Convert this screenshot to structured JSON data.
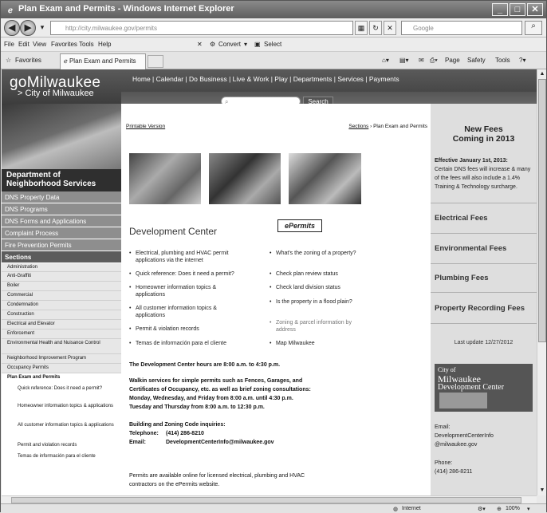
{
  "window": {
    "title": "Plan Exam and Permits - Windows Internet Explorer",
    "address": "http://city.milwaukee.gov/permits",
    "address_domain": "milwaukee.gov",
    "search_placeholder": "Google",
    "menus": [
      "File",
      "Edit",
      "View",
      "Favorites",
      "Tools",
      "Help"
    ],
    "toolbar_convert": "Convert",
    "toolbar_select": "Select",
    "favorites": "Favorites",
    "tab_title": "Plan Exam and Permits",
    "cmd_page": "Page",
    "cmd_safety": "Safety",
    "cmd_tools": "Tools",
    "status_zone": "Internet",
    "status_zoom": "100%"
  },
  "site": {
    "logo_main": "goMilwaukee",
    "logo_sub": "> City of Milwaukee",
    "topnav": "Home  |  Calendar  |  Do Business  |  Live & Work  |  Play  |  Departments  |  Services  |  Payments",
    "search_button": "Search",
    "department": "Department of Neighborhood Services"
  },
  "leftnav": {
    "main_links": [
      "DNS Property Data",
      "DNS Programs",
      "DNS Forms and Applications",
      "Complaint Process",
      "Fire Prevention Permits"
    ],
    "sections_label": "Sections",
    "sections": [
      "Administration",
      "Anti-Graffiti",
      "Boiler",
      "Commercial",
      "Condemnation",
      "Construction",
      "Electrical and Elevator",
      "Enforcement",
      "Environmental Health and Nuisance Control",
      "Neighborhood Improvement Program",
      "Occupancy Permits",
      "Plan Exam and Permits"
    ],
    "subsections": [
      "Quick reference: Does it need a permit?",
      "Homeowner information topics & applications",
      "All customer information topics & applications",
      "Permit and violation records",
      "Temas de información para el cliente"
    ]
  },
  "main": {
    "printable": "Printable Version",
    "crumb_sections": "Sections",
    "crumb_sep": " › ",
    "crumb_current": "Plan Exam and Permits",
    "title": "Development Center",
    "epermits_logo": "ePermits",
    "left_bullets": [
      "Electrical, plumbing and HVAC permit applications via the internet",
      "Quick reference: Does it need a permit?",
      "Homeowner information topics & applications",
      "All customer information topics & applications",
      "Permit & violation records",
      "Temas de información para el cliente"
    ],
    "right_bullets": [
      "What's the zoning of a property?",
      "Check plan review status",
      "Check land division status",
      "Is the property in a flood plain?",
      "Zoning & parcel information by address",
      "Map Milwaukee"
    ],
    "hours": "The Development Center hours are 8:00 a.m. to 4:30 p.m.",
    "walkin_1": "Walkin services for simple permits such as Fences, Garages, and",
    "walkin_2": "Certificates of Occupancy, etc. as well as brief zoning consultations:",
    "walkin_3": "Monday, Wednesday, and Friday from 8:00 a.m. until 4:30 p.m.",
    "walkin_4": "Tuesday and Thursday from 8:00 a.m. to 12:30 p.m.",
    "code_heading": "Building and Zoning Code inquiries:",
    "phone_label": "Telephone:",
    "phone": "(414) 286-8210",
    "email_label": "Email:",
    "email": "DevelopmentCenterInfo@milwaukee.gov",
    "online_1": "Permits are available online for licensed electrical, plumbing and HVAC",
    "online_2": "contractors on the ePermits website."
  },
  "rightcol": {
    "newfees_1": "New Fees",
    "newfees_2": "Coming in 2013",
    "effective_bold": "Effective January 1st, 2013:",
    "effective_text": "Certain DNS fees will increase & many of the fees will also include a 1.4% Training & Technology surcharge.",
    "fees": [
      "Electrical Fees",
      "Environmental Fees",
      "Plumbing Fees",
      "Property Recording Fees"
    ],
    "last_update": "Last update 12/27/2012",
    "devimg_1": "City of",
    "devimg_2": "Milwaukee",
    "devimg_3": "Development Center",
    "email_label": "Email:",
    "email_1": "DevelopmentCenterInfo",
    "email_2": "@milwaukee.gov",
    "phone_label": "Phone:",
    "phone": "(414) 286-8211"
  }
}
